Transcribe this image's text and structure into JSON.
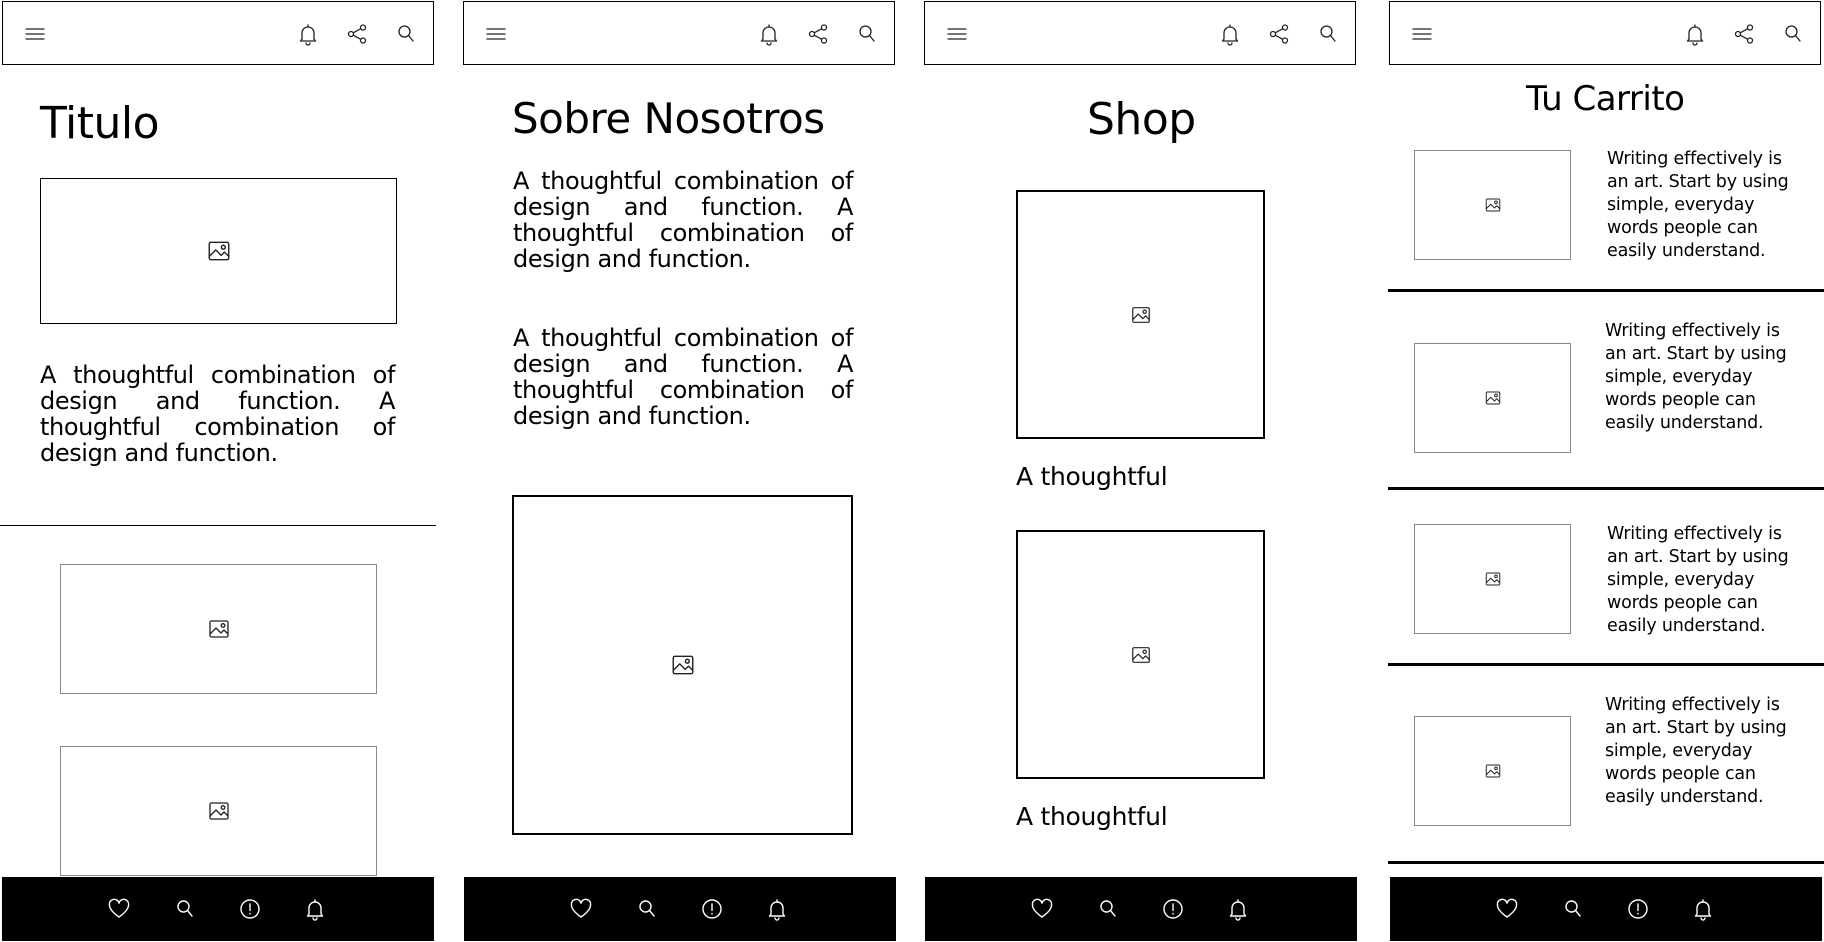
{
  "icons": {
    "menu": "hamburger-menu-icon",
    "notifications": "bell-icon",
    "share": "share-icon",
    "search": "search-icon",
    "favorites": "heart-icon",
    "alert": "exclamation-circle-icon",
    "image": "image-placeholder-icon"
  },
  "screen1": {
    "title": "Titulo",
    "paragraph": "A thoughtful combination of design and function. A thoughtful combination of design and function."
  },
  "screen2": {
    "title": "Sobre Nosotros",
    "paragraph1": "A thoughtful combination of design and function. A thoughtful combination of design and function.",
    "paragraph2": "A thoughtful combination of design and function. A thoughtful combination of design and function."
  },
  "screen3": {
    "title": "Shop",
    "products": [
      {
        "caption": "A thoughtful"
      },
      {
        "caption": "A thoughtful"
      }
    ]
  },
  "screen4": {
    "title": "Tu Carrito",
    "items": [
      {
        "text": "Writing effectively is an art. Start by using simple, everyday words people can easily understand."
      },
      {
        "text": "Writing effectively is an art. Start by using simple, everyday words people can easily understand."
      },
      {
        "text": "Writing effectively is an art. Start by using simple, everyday words people can easily understand."
      },
      {
        "text": "Writing effectively is an art. Start by using simple, everyday words people can easily understand."
      }
    ]
  }
}
